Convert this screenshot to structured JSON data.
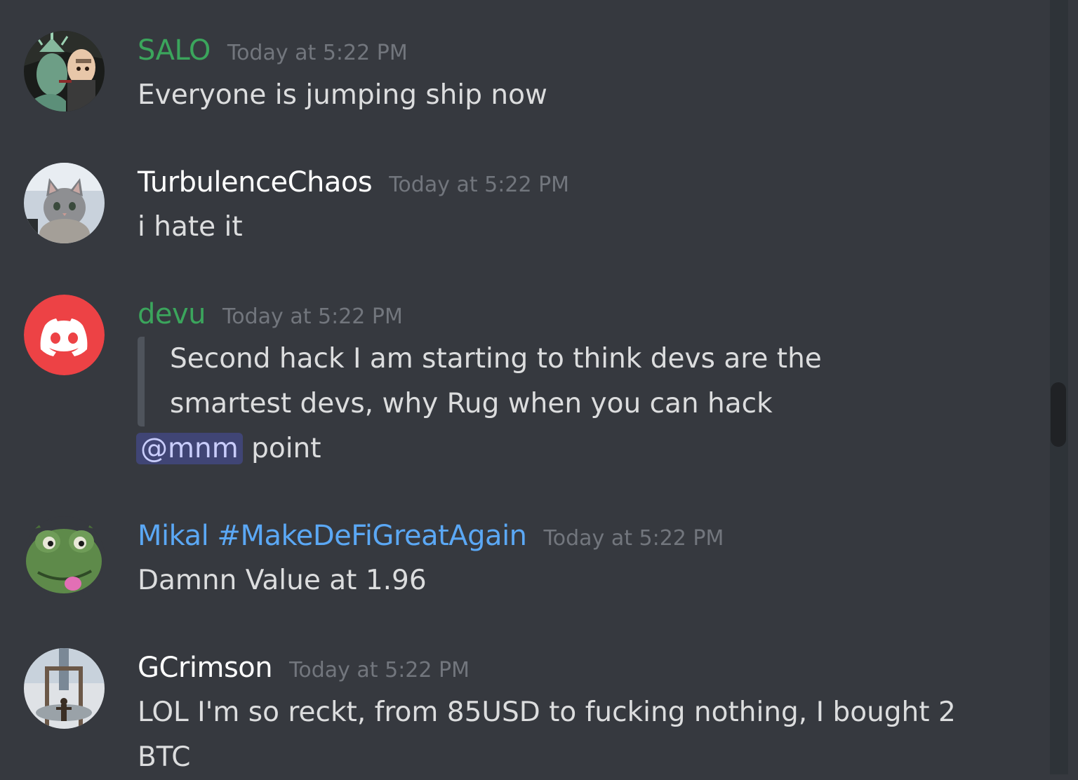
{
  "colors": {
    "background": "#36393f",
    "green_role": "#3ba55c",
    "white_name": "#ffffff",
    "blue_role": "#5ba8f5",
    "timestamp": "#72767d",
    "discord_red": "#ed4245"
  },
  "messages": [
    {
      "username": "SALO",
      "timestamp": "Today at 5:22 PM",
      "text": "Everyone is jumping ship now",
      "avatar": "statue-of-liberty-avatar"
    },
    {
      "username": "TurbulenceChaos",
      "timestamp": "Today at 5:22 PM",
      "text": "i hate it",
      "avatar": "kitten-avatar"
    },
    {
      "username": "devu",
      "timestamp": "Today at 5:22 PM",
      "quote_lines": [
        "Second hack I am starting to think devs are the",
        "smartest devs, why Rug when you can hack"
      ],
      "mention": "@mnm",
      "text_after_mention": "point",
      "avatar": "discord-default-avatar"
    },
    {
      "username": "Mikal #MakeDeFiGreatAgain",
      "timestamp": "Today at 5:22 PM",
      "text": "Damnn Value at 1.96",
      "avatar": "frog-avatar"
    },
    {
      "username": "GCrimson",
      "timestamp": "Today at 5:22 PM",
      "text_lines": [
        "LOL I'm so reckt, from 85USD to fucking nothing, I bought 2",
        "BTC"
      ],
      "avatar": "tower-figure-avatar"
    }
  ]
}
